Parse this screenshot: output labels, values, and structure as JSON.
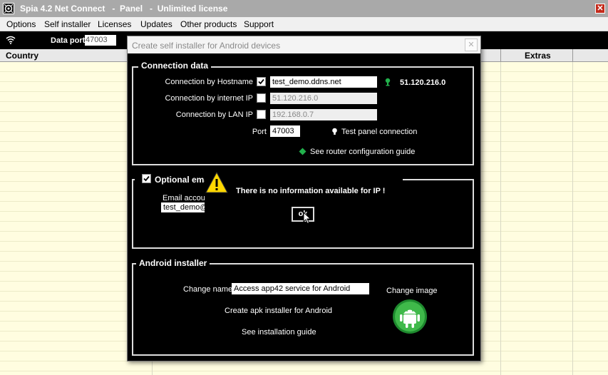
{
  "app": {
    "title": "Spia 4.2 Net Connect   -  Panel   -  Unlimited license",
    "close_glyph": "✕"
  },
  "menu": {
    "items": [
      "Options",
      "Self installer",
      "Licenses",
      "Updates",
      "Other products",
      "Support"
    ]
  },
  "toolbar": {
    "data_port_label": "Data port",
    "data_port_value": "47003"
  },
  "table": {
    "columns": [
      "Country",
      "Extras"
    ]
  },
  "dialog": {
    "title": "Create self installer for Android devices",
    "close_glyph": "✕",
    "connection": {
      "legend": "Connection data",
      "hostname_label": "Connection by Hostname",
      "hostname_checked": true,
      "hostname_value": "test_demo.ddns.net",
      "public_ip": "51.120.216.0",
      "internet_ip_label": "Connection by internet IP",
      "internet_ip_checked": false,
      "internet_ip_value": "51.120.216.0",
      "lan_ip_label": "Connection by LAN IP",
      "lan_ip_checked": false,
      "lan_ip_value": "192.168.0.7",
      "port_label": "Port",
      "port_value": "47003",
      "test_connection_label": "Test panel connection",
      "router_guide_label": "See router configuration guide"
    },
    "email": {
      "legend": "Optional ema",
      "checked": true,
      "account_label": "Email accour",
      "account_value": "test_demo@"
    },
    "warning": {
      "message": "There is no information available for IP !",
      "ok_label": "ok",
      "icon": "warning-icon"
    },
    "android": {
      "legend": "Android installer",
      "change_name_label": "Change name",
      "change_name_value": "Access app42 service for Android",
      "change_image_label": "Change image",
      "create_apk_label": "Create apk installer for Android",
      "install_guide_label": "See installation guide",
      "icon": "android-icon"
    }
  },
  "colors": {
    "accent_green": "#22b14c",
    "grid_bg": "#fffde0",
    "dialog_bg": "#000000",
    "titlebar": "#a9a9a9"
  }
}
